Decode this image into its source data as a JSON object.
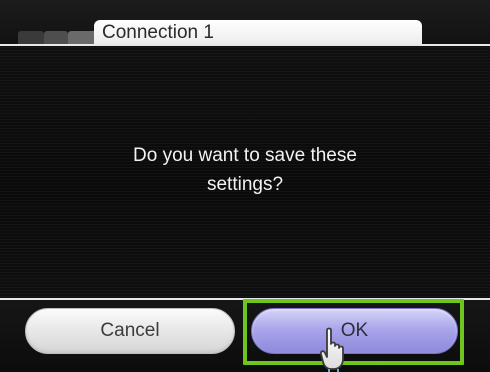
{
  "header": {
    "title": "Connection 1"
  },
  "dialog": {
    "message_line1": "Do you want to save these",
    "message_line2": "settings?"
  },
  "buttons": {
    "cancel_label": "Cancel",
    "ok_label": "OK",
    "highlight_color": "#6ec51e"
  },
  "cursor": {
    "icon": "hand-pointer-icon"
  }
}
